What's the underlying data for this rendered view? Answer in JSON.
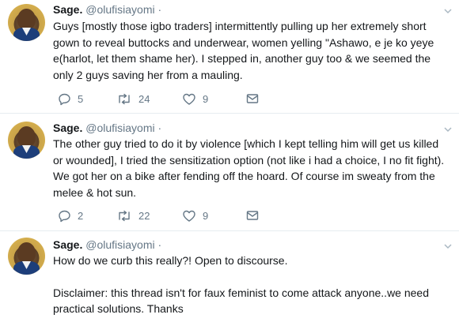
{
  "tweets": [
    {
      "name": "Sage.",
      "handle": "@olufisiayomi",
      "dot": "·",
      "time": "",
      "paragraphs": [
        "Guys [mostly those igbo traders] intermittently pulling up her extremely short gown to reveal buttocks and underwear, women yelling \"Ashawo, e je ko yeye e(harlot, let them shame her). I stepped in, another guy too & we seemed the only 2 guys saving her from a mauling."
      ],
      "replies": "5",
      "retweets": "24",
      "likes": "9"
    },
    {
      "name": "Sage.",
      "handle": "@olufisiayomi",
      "dot": "·",
      "time": "",
      "paragraphs": [
        "The other guy tried to do it by violence [which I kept telling him will get us killed or wounded], I tried the sensitization option (not like i had a choice, I no fit fight). We got her on a bike after fending off the hoard. Of course im sweaty from the melee & hot sun."
      ],
      "replies": "2",
      "retweets": "22",
      "likes": "9"
    },
    {
      "name": "Sage.",
      "handle": "@olufisiayomi",
      "dot": "·",
      "time": "",
      "paragraphs": [
        "How do we curb this really?! Open to discourse.",
        "Disclaimer: this thread isn't for faux feminist to come attack anyone..we need practical solutions. Thanks"
      ]
    }
  ],
  "icons": {
    "reply": "reply-icon",
    "retweet": "retweet-icon",
    "like": "heart-icon",
    "message": "envelope-icon",
    "caret": "chevron-down-icon"
  },
  "colors": {
    "text": "#14171a",
    "secondary": "#657786",
    "divider": "#e6ecf0",
    "avatar_bg": "#e0b94f"
  }
}
